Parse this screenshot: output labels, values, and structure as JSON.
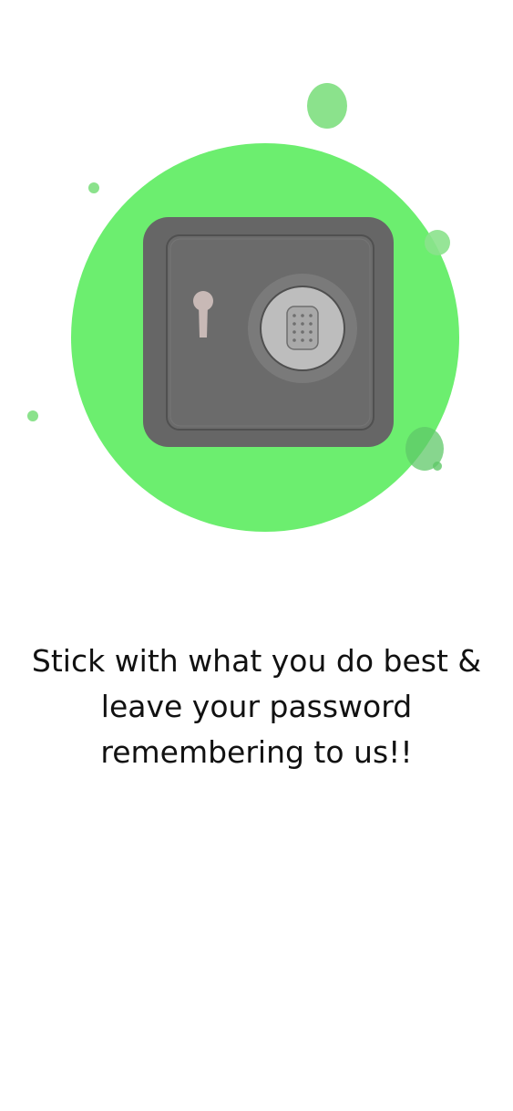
{
  "onboarding": {
    "illustration_icon": "safe-vault-icon",
    "tagline_lines": [
      "Stick with what you do best &",
      "leave your password",
      "remembering to us!!"
    ]
  },
  "colors": {
    "accent_green": "#6CEE6F",
    "bubble_green": "#8BE28C",
    "safe_body": "#666666",
    "safe_border": "#595959",
    "dial_outer": "#7a7a7a",
    "dial_inner": "#bdbdbd",
    "keyhole": "#c8b9b6",
    "background": "#FFFFFF",
    "text": "#111111"
  }
}
